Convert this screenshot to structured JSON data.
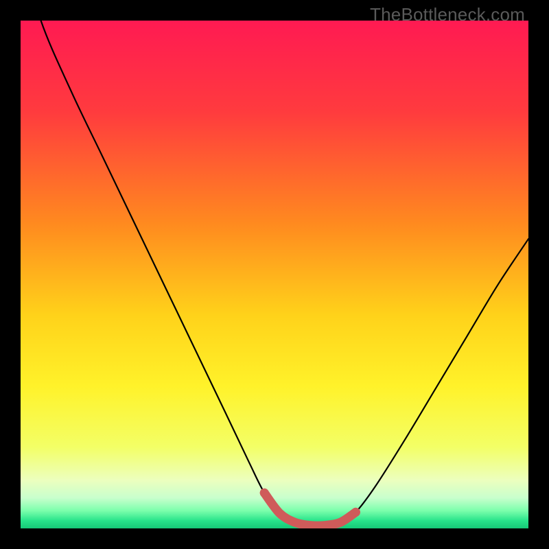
{
  "watermark": "TheBottleneck.com",
  "colors": {
    "frame": "#000000",
    "watermark": "#5a5a5a",
    "curve": "#000000",
    "marker": "#cf5b5a",
    "gradient_stops": [
      {
        "offset": 0.0,
        "color": "#ff1a52"
      },
      {
        "offset": 0.18,
        "color": "#ff3b3e"
      },
      {
        "offset": 0.4,
        "color": "#ff8a1f"
      },
      {
        "offset": 0.58,
        "color": "#ffd21a"
      },
      {
        "offset": 0.72,
        "color": "#fff22a"
      },
      {
        "offset": 0.84,
        "color": "#f3ff66"
      },
      {
        "offset": 0.905,
        "color": "#ecffbe"
      },
      {
        "offset": 0.94,
        "color": "#c8ffcd"
      },
      {
        "offset": 0.965,
        "color": "#7cffac"
      },
      {
        "offset": 0.985,
        "color": "#27e38a"
      },
      {
        "offset": 1.0,
        "color": "#16c877"
      }
    ]
  },
  "chart_data": {
    "type": "line",
    "title": "",
    "xlabel": "",
    "ylabel": "",
    "xlim": [
      0,
      100
    ],
    "ylim": [
      0,
      100
    ],
    "grid": false,
    "x": [
      0,
      4,
      10,
      16,
      22,
      28,
      34,
      40,
      45,
      48,
      51,
      54,
      57,
      60,
      63,
      66,
      70,
      76,
      82,
      88,
      94,
      100
    ],
    "values": [
      115,
      100,
      86,
      73.5,
      61,
      48.5,
      36,
      23.5,
      13,
      7,
      3,
      1.2,
      0.6,
      0.6,
      1.2,
      3.2,
      8.5,
      18,
      28,
      38,
      48,
      57
    ],
    "marker_region_x": [
      48,
      66
    ],
    "series": [
      {
        "name": "bottleneck-curve",
        "x_ref": "x",
        "y_ref": "values"
      }
    ]
  }
}
